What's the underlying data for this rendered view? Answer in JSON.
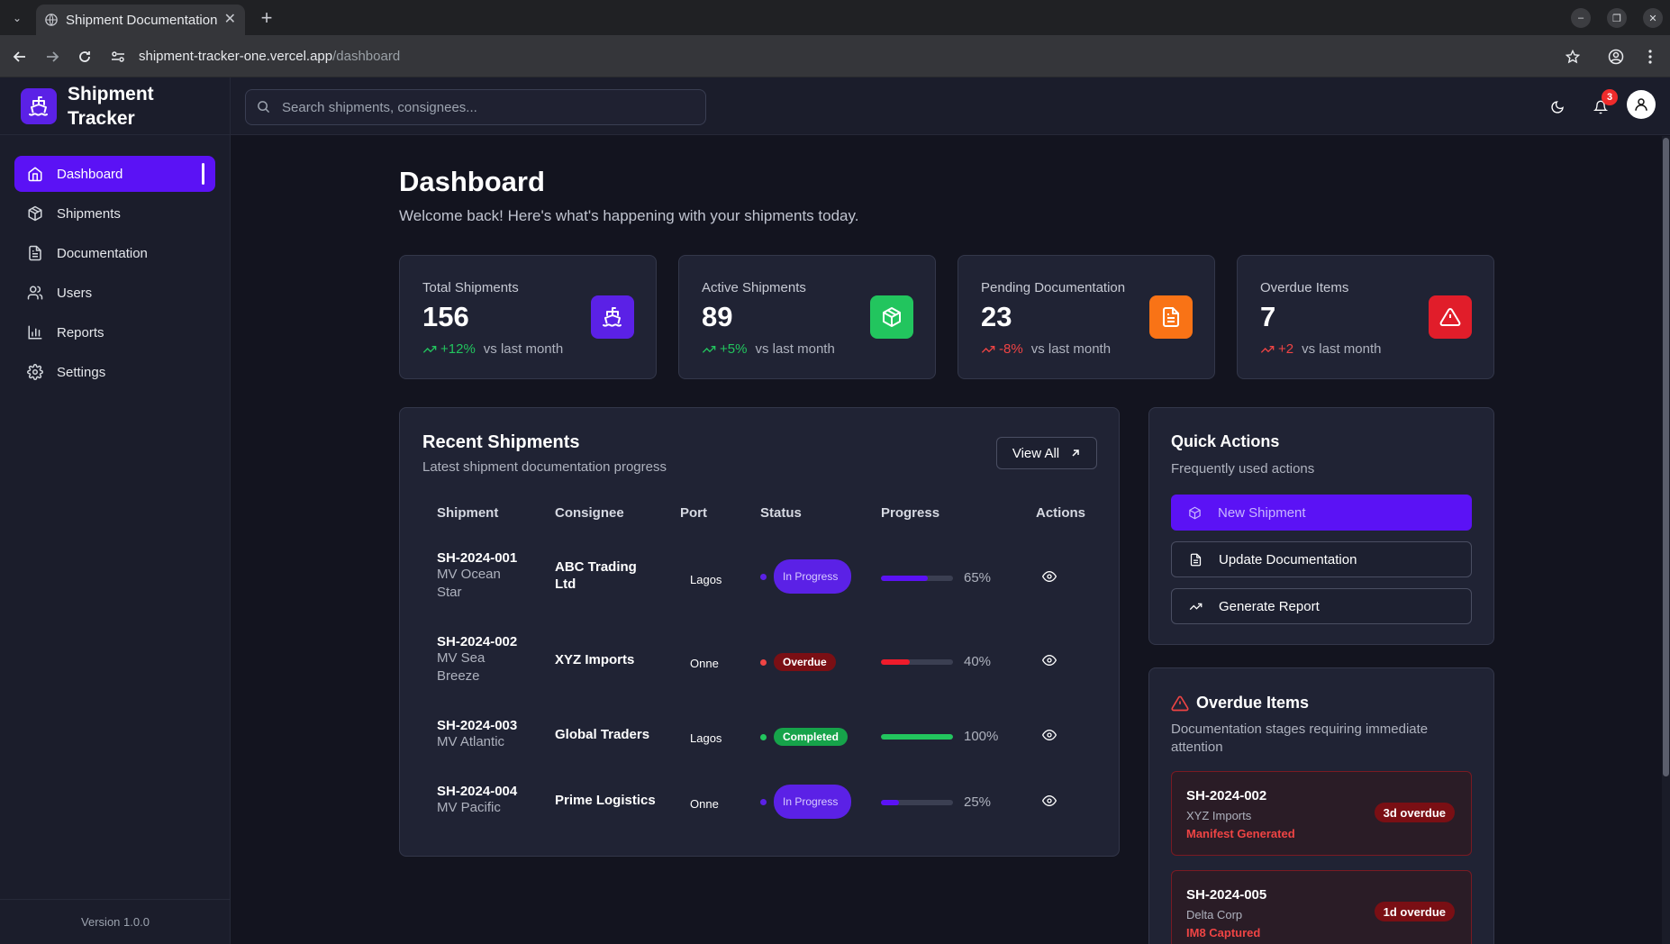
{
  "browser": {
    "tab_title": "Shipment Documentation",
    "url_host": "shipment-tracker-one.vercel.app",
    "url_path": "/dashboard",
    "new_tab_glyph": "+",
    "close_glyph": "✕"
  },
  "app": {
    "name": "Shipment Tracker",
    "version": "Version 1.0.0",
    "accent": "#5b12f5"
  },
  "sidebar": {
    "items": [
      {
        "label": "Dashboard",
        "icon": "home-icon",
        "active": true
      },
      {
        "label": "Shipments",
        "icon": "package-icon"
      },
      {
        "label": "Documentation",
        "icon": "document-icon"
      },
      {
        "label": "Users",
        "icon": "users-icon"
      },
      {
        "label": "Reports",
        "icon": "bar-chart-icon"
      },
      {
        "label": "Settings",
        "icon": "gear-icon"
      }
    ]
  },
  "topbar": {
    "search_placeholder": "Search shipments, consignees...",
    "notification_count": "3"
  },
  "page": {
    "title": "Dashboard",
    "subtitle": "Welcome back! Here's what's happening with your shipments today."
  },
  "stats": [
    {
      "label": "Total Shipments",
      "value": "156",
      "delta": "+12%",
      "vs": "vs last month",
      "trend": "up",
      "icon": "ship-icon",
      "color": "#5b21e6"
    },
    {
      "label": "Active Shipments",
      "value": "89",
      "delta": "+5%",
      "vs": "vs last month",
      "trend": "up",
      "icon": "package-icon",
      "color": "#22c55e"
    },
    {
      "label": "Pending Documentation",
      "value": "23",
      "delta": "-8%",
      "vs": "vs last month",
      "trend": "down",
      "icon": "document-icon",
      "color": "#f97316"
    },
    {
      "label": "Overdue Items",
      "value": "7",
      "delta": "+2",
      "vs": "vs last month",
      "trend": "bad",
      "icon": "alert-icon",
      "color": "#e11d2a"
    }
  ],
  "recent": {
    "title": "Recent Shipments",
    "subtitle": "Latest shipment documentation progress",
    "view_all": "View All",
    "columns": [
      "Shipment",
      "Consignee",
      "Port",
      "Status",
      "Progress",
      "Actions"
    ],
    "rows": [
      {
        "id": "SH-2024-001",
        "vessel": "MV Ocean Star",
        "consignee": "ABC Trading Ltd",
        "port": "Lagos",
        "status": "In Progress",
        "status_type": "progress",
        "progress": 65,
        "progress_label": "65%"
      },
      {
        "id": "SH-2024-002",
        "vessel": "MV Sea Breeze",
        "consignee": "XYZ Imports",
        "port": "Onne",
        "status": "Overdue",
        "status_type": "overdue",
        "progress": 40,
        "progress_label": "40%"
      },
      {
        "id": "SH-2024-003",
        "vessel": "MV Atlantic",
        "consignee": "Global Traders",
        "port": "Lagos",
        "status": "Completed",
        "status_type": "done",
        "progress": 100,
        "progress_label": "100%"
      },
      {
        "id": "SH-2024-004",
        "vessel": "MV Pacific",
        "consignee": "Prime Logistics",
        "port": "Onne",
        "status": "In Progress",
        "status_type": "progress",
        "progress": 25,
        "progress_label": "25%"
      }
    ]
  },
  "quick_actions": {
    "title": "Quick Actions",
    "subtitle": "Frequently used actions",
    "buttons": [
      {
        "label": "New Shipment",
        "icon": "package-icon"
      },
      {
        "label": "Update Documentation",
        "icon": "document-icon"
      },
      {
        "label": "Generate Report",
        "icon": "trending-up-icon"
      }
    ]
  },
  "overdue": {
    "title": "Overdue Items",
    "subtitle": "Documentation stages requiring immediate attention",
    "items": [
      {
        "id": "SH-2024-002",
        "consignee": "XYZ Imports",
        "stage": "Manifest Generated",
        "badge": "3d overdue"
      },
      {
        "id": "SH-2024-005",
        "consignee": "Delta Corp",
        "stage": "IM8 Captured",
        "badge": "1d overdue"
      }
    ]
  }
}
